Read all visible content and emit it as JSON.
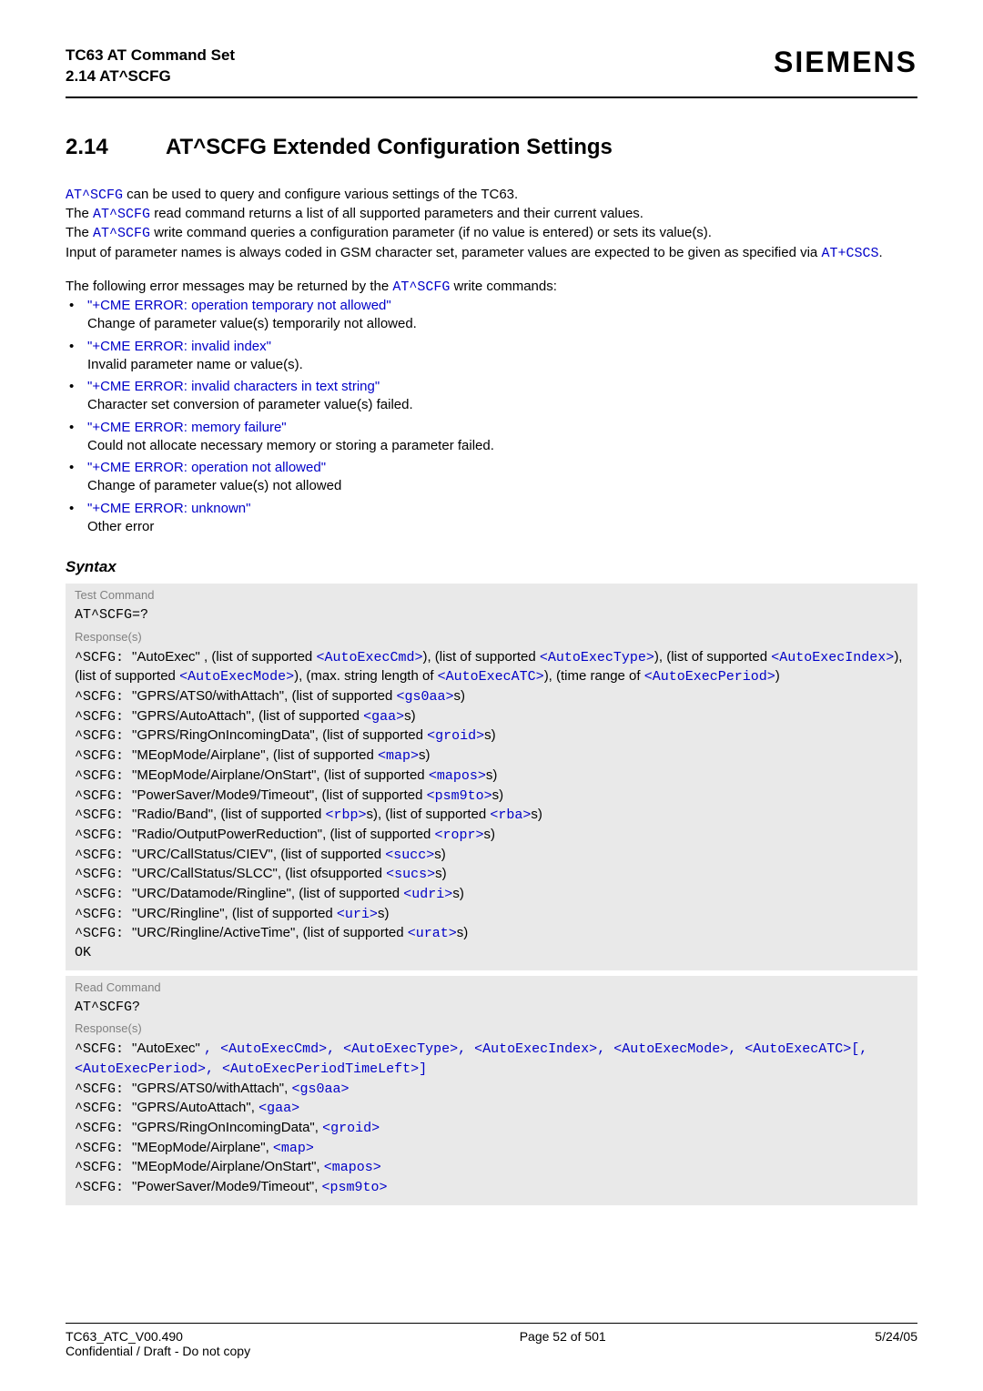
{
  "header": {
    "title_line1": "TC63 AT Command Set",
    "title_line2": "2.14 AT^SCFG",
    "logo": "SIEMENS"
  },
  "section": {
    "number": "2.14",
    "title": "AT^SCFG   Extended Configuration Settings"
  },
  "intro": {
    "p1": {
      "cmd1": "AT^SCFG",
      "t1": " can be used to query and configure various settings of the TC63.",
      "t2a": "The ",
      "cmd2": "AT^SCFG",
      "t2b": " read command returns a list of all supported parameters and their current values.",
      "t3a": "The ",
      "cmd3": "AT^SCFG",
      "t3b": " write command queries a configuration parameter (if no value is entered) or sets its value(s).",
      "t4a": "Input of parameter names is always coded in GSM character set, parameter values are expected to be given as specified via ",
      "cmd4": "AT+CSCS",
      "t4b": "."
    },
    "p2": {
      "t1": "The following error messages may be returned by the ",
      "cmd": "AT^SCFG",
      "t2": " write commands:"
    }
  },
  "errors": [
    {
      "err": "\"+CME ERROR: operation temporary not allowed\"",
      "desc": "Change of parameter value(s) temporarily not allowed."
    },
    {
      "err": "\"+CME ERROR: invalid index\"",
      "desc": "Invalid parameter name or value(s)."
    },
    {
      "err": "\"+CME ERROR: invalid characters in text string\"",
      "desc": "Character set conversion of parameter value(s) failed."
    },
    {
      "err": "\"+CME ERROR: memory failure\"",
      "desc": "Could not allocate necessary memory or storing a parameter failed."
    },
    {
      "err": "\"+CME ERROR: operation not allowed\"",
      "desc": "Change of parameter value(s) not allowed"
    },
    {
      "err": "\"+CME ERROR: unknown\"",
      "desc": "Other error"
    }
  ],
  "syntax_label": "Syntax",
  "test_block": {
    "label": "Test Command",
    "cmd": "AT^SCFG=?",
    "resp_label": "Response(s)",
    "lines": {
      "l1a": "^SCFG: ",
      "l1b": "\"AutoExec\" , (list of supported ",
      "l1c": "<AutoExecCmd>",
      "l1d": "), (list of supported ",
      "l1e": "<AutoExecType>",
      "l1f": "), (list of supported ",
      "l1g": "<AutoExecIndex>",
      "l1h": "), (list of supported ",
      "l1i": "<AutoExecMode>",
      "l1j": "), (max. string length of ",
      "l1k": "<AutoExecATC>",
      "l1l": "), (time range of ",
      "l1m": "<AutoExecPeriod>",
      "l1n": ")",
      "l2a": "^SCFG: ",
      "l2b": "\"GPRS/ATS0/withAttach\", (list of supported ",
      "l2c": "<gs0aa>",
      "l2d": "s)",
      "l3a": "^SCFG: ",
      "l3b": "\"GPRS/AutoAttach\", (list of supported ",
      "l3c": "<gaa>",
      "l3d": "s)",
      "l4a": "^SCFG: ",
      "l4b": "\"GPRS/RingOnIncomingData\", (list of supported ",
      "l4c": "<groid>",
      "l4d": "s)",
      "l5a": "^SCFG: ",
      "l5b": "\"MEopMode/Airplane\", (list of supported ",
      "l5c": "<map>",
      "l5d": "s)",
      "l6a": "^SCFG: ",
      "l6b": "\"MEopMode/Airplane/OnStart\", (list of supported ",
      "l6c": "<mapos>",
      "l6d": "s)",
      "l7a": "^SCFG: ",
      "l7b": "\"PowerSaver/Mode9/Timeout\", (list of supported ",
      "l7c": "<psm9to>",
      "l7d": "s)",
      "l8a": "^SCFG: ",
      "l8b": "\"Radio/Band\", (list of supported ",
      "l8c": "<rbp>",
      "l8d": "s), (list of supported ",
      "l8e": "<rba>",
      "l8f": "s)",
      "l9a": "^SCFG: ",
      "l9b": "\"Radio/OutputPowerReduction\", (list of supported ",
      "l9c": "<ropr>",
      "l9d": "s)",
      "l10a": "^SCFG: ",
      "l10b": "\"URC/CallStatus/CIEV\", (list of supported ",
      "l10c": "<succ>",
      "l10d": "s)",
      "l11a": "^SCFG: ",
      "l11b": "\"URC/CallStatus/SLCC\", (list ofsupported ",
      "l11c": "<sucs>",
      "l11d": "s)",
      "l12a": "^SCFG: ",
      "l12b": "\"URC/Datamode/Ringline\", (list of supported ",
      "l12c": "<udri>",
      "l12d": "s)",
      "l13a": "^SCFG: ",
      "l13b": "\"URC/Ringline\", (list of supported ",
      "l13c": "<uri>",
      "l13d": "s)",
      "l14a": "^SCFG: ",
      "l14b": "\"URC/Ringline/ActiveTime\", (list of supported ",
      "l14c": "<urat>",
      "l14d": "s)",
      "ok": "OK"
    }
  },
  "read_block": {
    "label": "Read Command",
    "cmd": "AT^SCFG?",
    "resp_label": "Response(s)",
    "lines": {
      "r1a": "^SCFG: ",
      "r1b": "\"AutoExec\" ",
      "r1c": ", ",
      "r1d": "<AutoExecCmd>",
      "r1e": ", ",
      "r1f": "<AutoExecType>",
      "r1g": ", ",
      "r1h": "<AutoExecIndex>",
      "r1i": ", ",
      "r1j": "<AutoExecMode>",
      "r1k": ", ",
      "r1l": "<AutoExecATC>",
      "r1m": "[",
      "r1n": ", ",
      "r1o": "<AutoExecPeriod>",
      "r1p": ", ",
      "r1q": "<AutoExecPeriodTimeLeft>",
      "r1r": "]",
      "r2a": "^SCFG: ",
      "r2b": "\"GPRS/ATS0/withAttach\", ",
      "r2c": "<gs0aa>",
      "r3a": "^SCFG: ",
      "r3b": "\"GPRS/AutoAttach\", ",
      "r3c": "<gaa>",
      "r4a": "^SCFG: ",
      "r4b": "\"GPRS/RingOnIncomingData\", ",
      "r4c": "<groid>",
      "r5a": "^SCFG: ",
      "r5b": "\"MEopMode/Airplane\", ",
      "r5c": "<map>",
      "r6a": "^SCFG: ",
      "r6b": "\"MEopMode/Airplane/OnStart\", ",
      "r6c": "<mapos>",
      "r7a": "^SCFG: ",
      "r7b": "\"PowerSaver/Mode9/Timeout\", ",
      "r7c": "<psm9to>"
    }
  },
  "footer": {
    "left1": "TC63_ATC_V00.490",
    "left2": "Confidential / Draft - Do not copy",
    "center": "Page 52 of 501",
    "right": "5/24/05"
  }
}
